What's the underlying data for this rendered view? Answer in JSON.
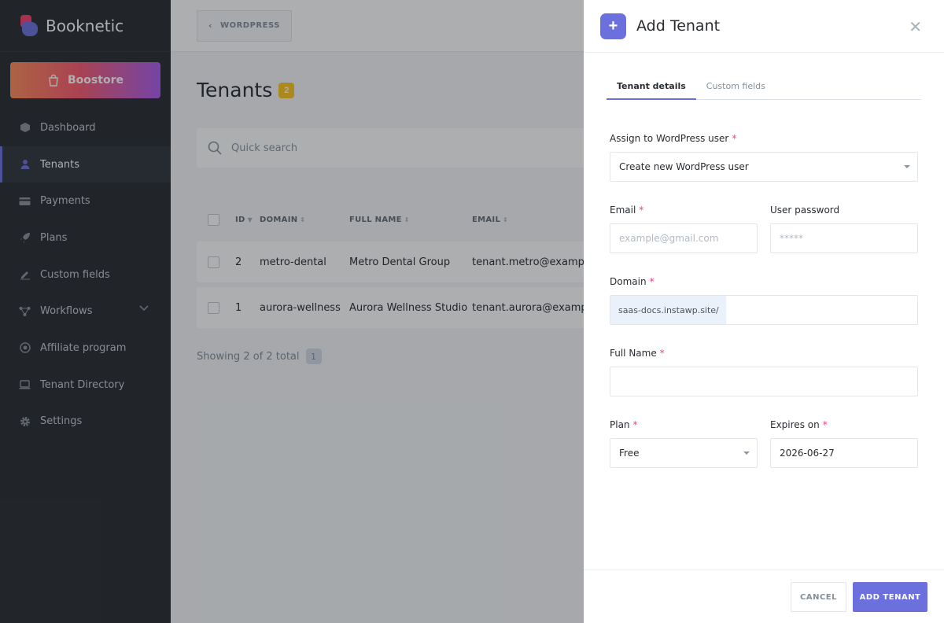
{
  "brand": {
    "name": "Booknetic"
  },
  "sidebar": {
    "boostore_label": "Boostore",
    "items": [
      {
        "label": "Dashboard",
        "icon": "cube-icon"
      },
      {
        "label": "Tenants",
        "icon": "user-icon",
        "active": true
      },
      {
        "label": "Payments",
        "icon": "credit-card-icon"
      },
      {
        "label": "Plans",
        "icon": "rocket-icon"
      },
      {
        "label": "Custom fields",
        "icon": "edit-icon"
      },
      {
        "label": "Workflows",
        "icon": "workflow-icon",
        "expandable": true
      },
      {
        "label": "Affiliate program",
        "icon": "target-icon"
      },
      {
        "label": "Tenant Directory",
        "icon": "laptop-icon"
      },
      {
        "label": "Settings",
        "icon": "gear-icon"
      }
    ]
  },
  "topbar": {
    "back_label": "WORDPRESS"
  },
  "page": {
    "title": "Tenants",
    "count": "2"
  },
  "search": {
    "placeholder": "Quick search"
  },
  "table": {
    "columns": [
      "ID",
      "DOMAIN",
      "FULL NAME",
      "EMAIL"
    ],
    "rows": [
      {
        "id": "2",
        "domain": "metro-dental",
        "full_name": "Metro Dental Group",
        "email": "tenant.metro@example"
      },
      {
        "id": "1",
        "domain": "aurora-wellness",
        "full_name": "Aurora Wellness Studio",
        "email": "tenant.aurora@example"
      }
    ],
    "showing": "Showing 2 of 2 total",
    "page": "1"
  },
  "panel": {
    "title": "Add Tenant",
    "tabs": [
      "Tenant details",
      "Custom fields"
    ],
    "fields": {
      "assign_label": "Assign to WordPress user",
      "assign_value": "Create new WordPress user",
      "email_label": "Email",
      "email_placeholder": "example@gmail.com",
      "password_label": "User password",
      "password_value": "*****",
      "domain_label": "Domain",
      "domain_prefix": "saas-docs.instawp.site/",
      "domain_value": "",
      "fullname_label": "Full Name",
      "fullname_value": "",
      "plan_label": "Plan",
      "plan_value": "Free",
      "expires_label": "Expires on",
      "expires_value": "2026-06-27",
      "required_mark": "*"
    },
    "cancel_label": "CANCEL",
    "submit_label": "ADD TENANT"
  },
  "colors": {
    "accent": "#6c70dc",
    "sidebar": "#292d32",
    "badge": "#fec71d",
    "required": "#fb3e6e"
  }
}
